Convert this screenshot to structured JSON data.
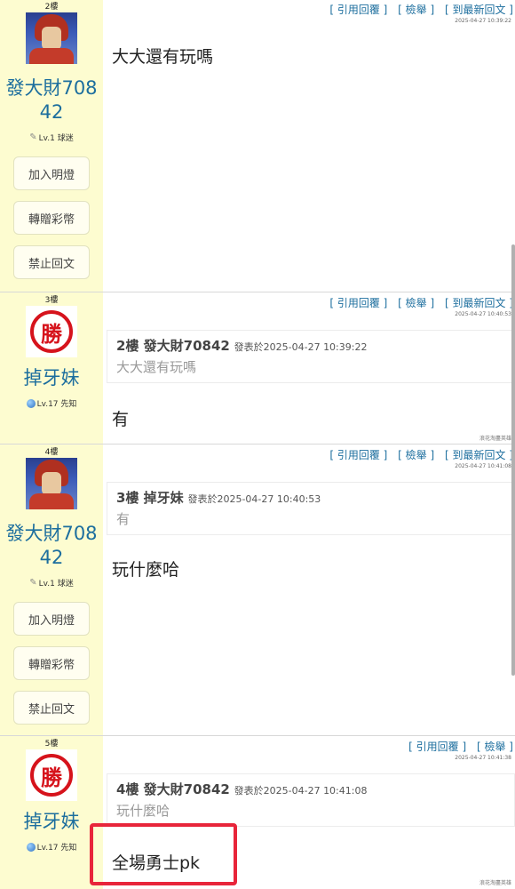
{
  "actions": {
    "quote": "[ 引用回覆 ]",
    "report": "[ 檢舉 ]",
    "latest": "[ 到最新回文 ]"
  },
  "side_buttons": {
    "light": "加入明燈",
    "gift": "轉贈彩幣",
    "ban": "禁止回文"
  },
  "posts": [
    {
      "floor": "2樓",
      "user": "發大財70842",
      "level": "Lv.1 球迷",
      "timestamp": "2025-04-27 10:39:22",
      "content": "大大還有玩嗎"
    },
    {
      "floor": "3樓",
      "user": "掉牙妹",
      "level": "Lv.17 先知",
      "timestamp": "2025-04-27 10:40:53",
      "quote": {
        "ref": "2樓 發大財70842",
        "posted": "發表於2025-04-27 10:39:22",
        "text": "大大還有玩嗎"
      },
      "content": "有",
      "signature": "浪花淘盡英雄"
    },
    {
      "floor": "4樓",
      "user": "發大財70842",
      "level": "Lv.1 球迷",
      "timestamp": "2025-04-27 10:41:08",
      "quote": {
        "ref": "3樓 掉牙妹",
        "posted": "發表於2025-04-27 10:40:53",
        "text": "有"
      },
      "content": "玩什麼哈"
    },
    {
      "floor": "5樓",
      "user": "掉牙妹",
      "level": "Lv.17 先知",
      "timestamp": "2025-04-27 10:41:38",
      "quote": {
        "ref": "4樓 發大財70842",
        "posted": "發表於2025-04-27 10:41:08",
        "text": "玩什麼哈"
      },
      "content": "全場勇士pk",
      "signature": "浪花淘盡英雄"
    }
  ],
  "avatar_text": "勝",
  "colors": {
    "sidebar": "#fdfcd0",
    "link": "#1c6e9e",
    "highlight": "#e8253a"
  }
}
